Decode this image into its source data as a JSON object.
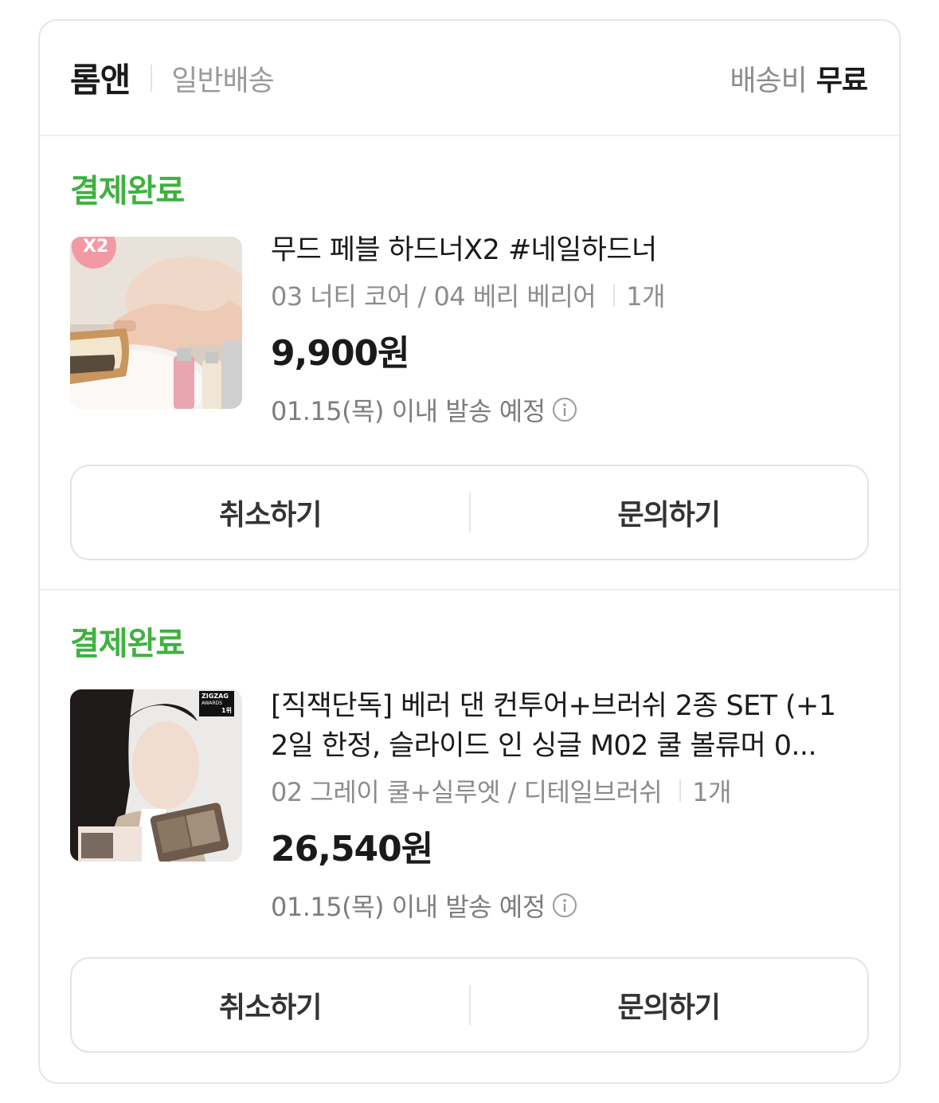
{
  "header": {
    "store_name": "롬앤",
    "shipping_type": "일반배송",
    "fee_label": "배송비",
    "fee_value": "무료"
  },
  "orders": [
    {
      "status": "결제완료",
      "thumb_badge": "X2",
      "title": "무드 페블 하드너X2 #네일하드너",
      "option": "03 너티 코어 / 04 베리 베리어",
      "quantity": "1개",
      "price": "9,900원",
      "ship_date": "01.15(목) 이내 발송 예정",
      "cancel_label": "취소하기",
      "inquiry_label": "문의하기"
    },
    {
      "status": "결제완료",
      "thumb_badge": "ZIGZAG",
      "thumb_badge_sub": "AWARDS",
      "thumb_badge_rank": "1위",
      "title_line1": "[직잭단독] 베러 댄 컨투어+브러쉬 2종 SET (+1",
      "title_line2": "2일 한정, 슬라이드 인 싱글 M02 쿨 볼류머 0...",
      "option": "02 그레이 쿨+실루엣 / 디테일브러쉬",
      "quantity": "1개",
      "price": "26,540원",
      "ship_date": "01.15(목) 이내 발송 예정",
      "cancel_label": "취소하기",
      "inquiry_label": "문의하기"
    }
  ],
  "colors": {
    "status_green": "#3fb13f",
    "border": "#e6e6e6"
  }
}
